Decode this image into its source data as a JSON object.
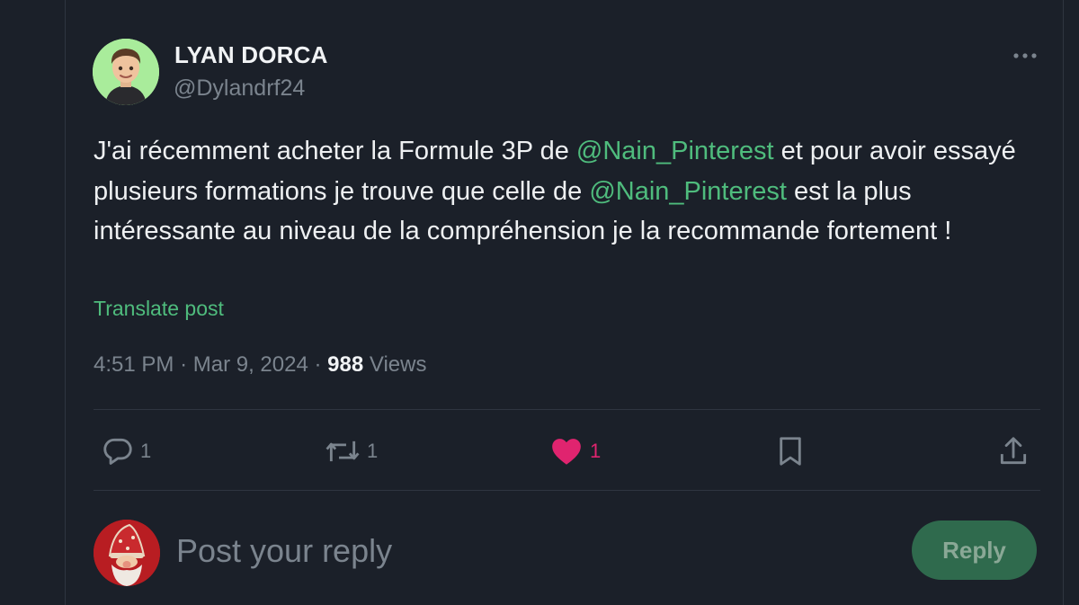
{
  "post": {
    "author_name": "LYAN DORCA",
    "author_handle": "@Dylandrf24",
    "text_parts": {
      "p1": "J'ai récemment acheter la Formule 3P de ",
      "m1": "@Nain_Pinterest",
      "p2": "  et pour avoir essayé plusieurs formations je trouve que celle de ",
      "m2": "@Nain_Pinterest",
      "p3": "  est la plus intéressante au niveau de la compréhension je la recommande fortement !"
    },
    "translate_label": "Translate post",
    "time": "4:51 PM",
    "date": "Mar 9, 2024",
    "separator": "·",
    "views_count": "988",
    "views_label": "Views"
  },
  "actions": {
    "reply_count": "1",
    "repost_count": "1",
    "like_count": "1",
    "liked": true
  },
  "composer": {
    "placeholder": "Post your reply",
    "reply_button": "Reply"
  },
  "icons": [
    "more-icon",
    "reply-icon",
    "repost-icon",
    "heart-icon",
    "bookmark-icon",
    "share-icon"
  ],
  "colors": {
    "background": "#1b2029",
    "accent": "#4fbc7d",
    "like": "#e0246f",
    "muted": "#7b848e",
    "reply_button_bg": "#2f6a4d"
  }
}
